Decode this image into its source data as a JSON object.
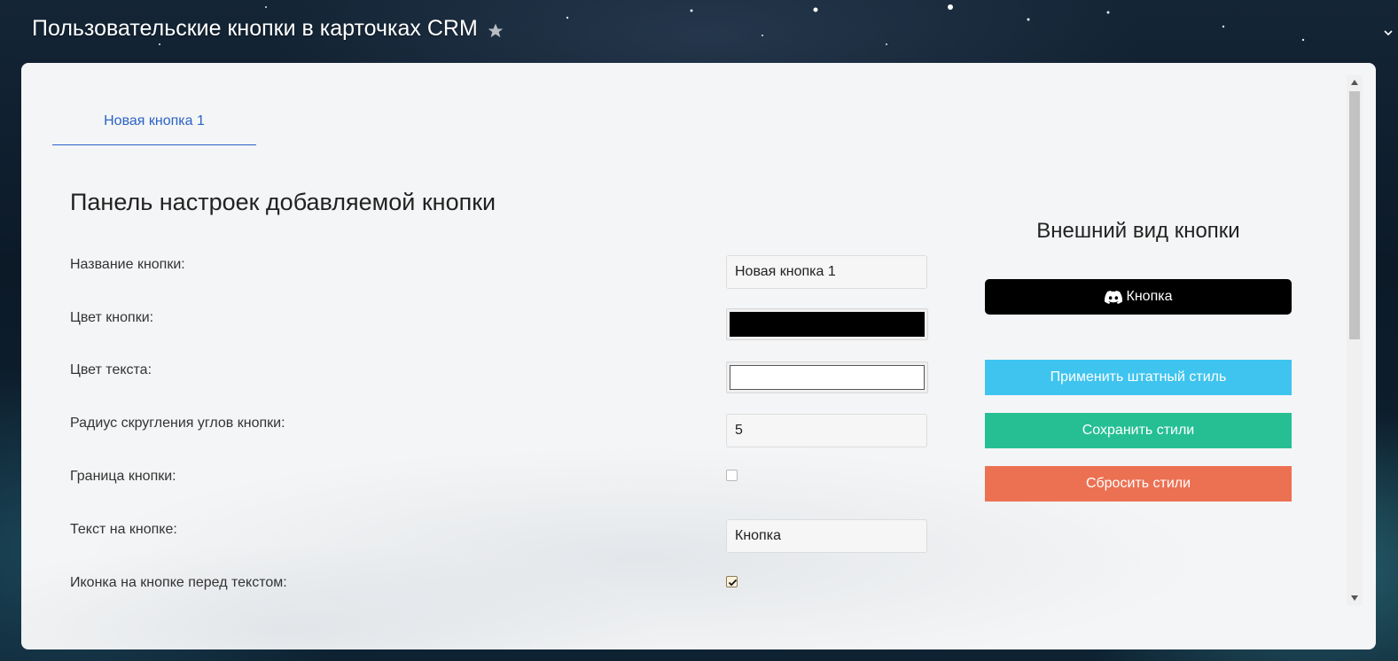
{
  "page": {
    "title": "Пользовательские кнопки в карточках CRM"
  },
  "tabs": [
    {
      "label": "Новая кнопка 1",
      "active": true
    }
  ],
  "settings": {
    "title": "Панель настроек добавляемой кнопки",
    "rows": {
      "name": {
        "label": "Название кнопки:",
        "value": "Новая кнопка 1"
      },
      "button_color": {
        "label": "Цвет кнопки:",
        "value": "#000000"
      },
      "text_color": {
        "label": "Цвет текста:",
        "value": "#ffffff"
      },
      "radius": {
        "label": "Радиус скругления углов кнопки:",
        "value": "5"
      },
      "border": {
        "label": "Граница кнопки:",
        "checked": false
      },
      "text": {
        "label": "Текст на кнопке:",
        "value": "Кнопка"
      },
      "icon": {
        "label": "Иконка на кнопке перед текстом:",
        "checked": true
      }
    }
  },
  "preview": {
    "title": "Внешний вид кнопки",
    "button_label": "Кнопка",
    "button_icon": "discord-icon"
  },
  "actions": {
    "apply_default": {
      "label": "Применить штатный стиль",
      "color": "#3fc4ef"
    },
    "save": {
      "label": "Сохранить стили",
      "color": "#26bf94"
    },
    "reset": {
      "label": "Сбросить стили",
      "color": "#ec7153"
    }
  }
}
